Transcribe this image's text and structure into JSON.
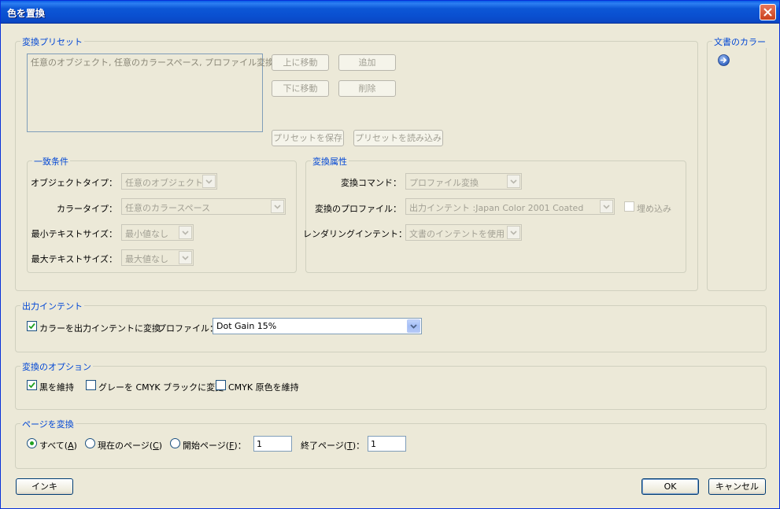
{
  "window": {
    "title": "色を置換"
  },
  "presets": {
    "legend": "変換プリセット",
    "list_items": [
      "任意のオブジェクト, 任意のカラースペース, プロファイル変換"
    ],
    "move_up": "上に移動",
    "add": "追加",
    "move_down": "下に移動",
    "delete": "削除",
    "save": "プリセットを保存",
    "load": "プリセットを読み込み"
  },
  "match": {
    "legend": "一致条件",
    "object_type_label": "オブジェクトタイプ：",
    "object_type_value": "任意のオブジェクト",
    "color_type_label": "カラータイプ：",
    "color_type_value": "任意のカラースペース",
    "min_text_label": "最小テキストサイズ：",
    "min_text_value": "最小値なし",
    "max_text_label": "最大テキストサイズ：",
    "max_text_value": "最大値なし"
  },
  "convert": {
    "legend": "変換属性",
    "command_label": "変換コマンド：",
    "command_value": "プロファイル変換",
    "profile_label": "変換のプロファイル：",
    "profile_value": "出力インテント :Japan Color 2001 Coated",
    "embed_label": "埋め込み",
    "intent_label": "レンダリングインテント：",
    "intent_value": "文書のインテントを使用"
  },
  "doc_colors": {
    "legend": "文書のカラー"
  },
  "output_intent": {
    "legend": "出力インテント",
    "convert_label": "カラーを出力インテントに変換",
    "profile_label": "プロファイル：",
    "profile_value": "Dot Gain 15%"
  },
  "options": {
    "legend": "変換のオプション",
    "keep_black": "黒を維持",
    "gray_to_cmyk": "グレーを CMYK ブラックに変更",
    "keep_cmyk_primary": "CMYK 原色を維持"
  },
  "pages": {
    "legend": "ページを変換",
    "all": "すべて",
    "all_key": "A",
    "current": "現在のページ",
    "current_key": "C",
    "start": "開始ページ",
    "start_key": "F",
    "start_value": "1",
    "end": "終了ページ",
    "end_key": "T",
    "end_value": "1"
  },
  "footer": {
    "ink": "インキ",
    "ok": "OK",
    "cancel": "キャンセル"
  }
}
